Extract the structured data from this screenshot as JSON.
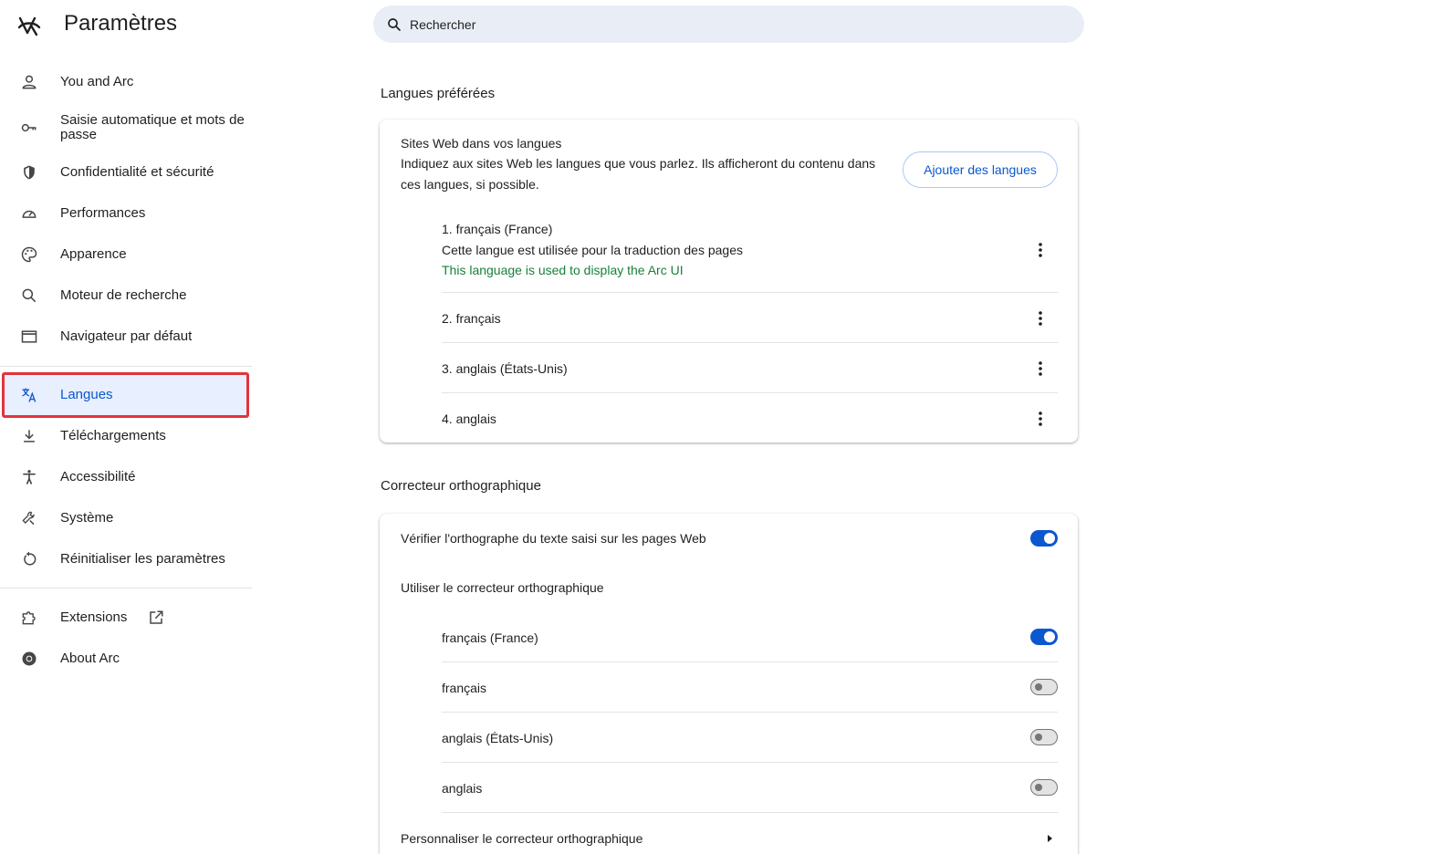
{
  "app": {
    "title": "Paramètres"
  },
  "search": {
    "placeholder": "Rechercher"
  },
  "sidebar": {
    "items": [
      {
        "label": "You and Arc",
        "icon": "person-icon"
      },
      {
        "label": "Saisie automatique et mots de passe",
        "icon": "key-icon"
      },
      {
        "label": "Confidentialité et sécurité",
        "icon": "shield-icon"
      },
      {
        "label": "Performances",
        "icon": "speedometer-icon"
      },
      {
        "label": "Apparence",
        "icon": "palette-icon"
      },
      {
        "label": "Moteur de recherche",
        "icon": "search-icon"
      },
      {
        "label": "Navigateur par défaut",
        "icon": "browser-window-icon"
      },
      {
        "label": "Langues",
        "icon": "translate-icon",
        "active": true
      },
      {
        "label": "Téléchargements",
        "icon": "download-icon"
      },
      {
        "label": "Accessibilité",
        "icon": "accessibility-icon"
      },
      {
        "label": "Système",
        "icon": "wrench-icon"
      },
      {
        "label": "Réinitialiser les paramètres",
        "icon": "reset-icon"
      },
      {
        "label": "Extensions",
        "icon": "puzzle-icon",
        "external_icon": "open-in-new-icon"
      },
      {
        "label": "About Arc",
        "icon": "chrome-icon"
      }
    ]
  },
  "preferred_languages": {
    "section_title": "Langues préférées",
    "header": "Sites Web dans vos langues",
    "description_line1": "Indiquez aux sites Web les langues que vous parlez. Ils afficheront du contenu dans",
    "description_line2": "ces langues, si possible.",
    "add_button": "Ajouter des langues",
    "languages": [
      {
        "label": "1. français (France)",
        "note": "Cette langue est utilisée pour la traduction des pages",
        "note2": "This language is used to display the Arc UI"
      },
      {
        "label": "2. français"
      },
      {
        "label": "3. anglais (États-Unis)"
      },
      {
        "label": "4. anglais"
      }
    ]
  },
  "spellcheck": {
    "section_title": "Correcteur orthographique",
    "check_label": "Vérifier l'orthographe du texte saisi sur les pages Web",
    "check_enabled": true,
    "use_label": "Utiliser le correcteur orthographique",
    "languages": [
      {
        "label": "français (France)",
        "enabled": true
      },
      {
        "label": "français",
        "enabled": false
      },
      {
        "label": "anglais (États-Unis)",
        "enabled": false
      },
      {
        "label": "anglais",
        "enabled": false
      }
    ],
    "customize_label": "Personnaliser le correcteur orthographique"
  },
  "colors": {
    "accent": "#0b57d0",
    "active_bg": "#e8efff",
    "highlight_border": "#e1343c",
    "green": "#188038"
  }
}
